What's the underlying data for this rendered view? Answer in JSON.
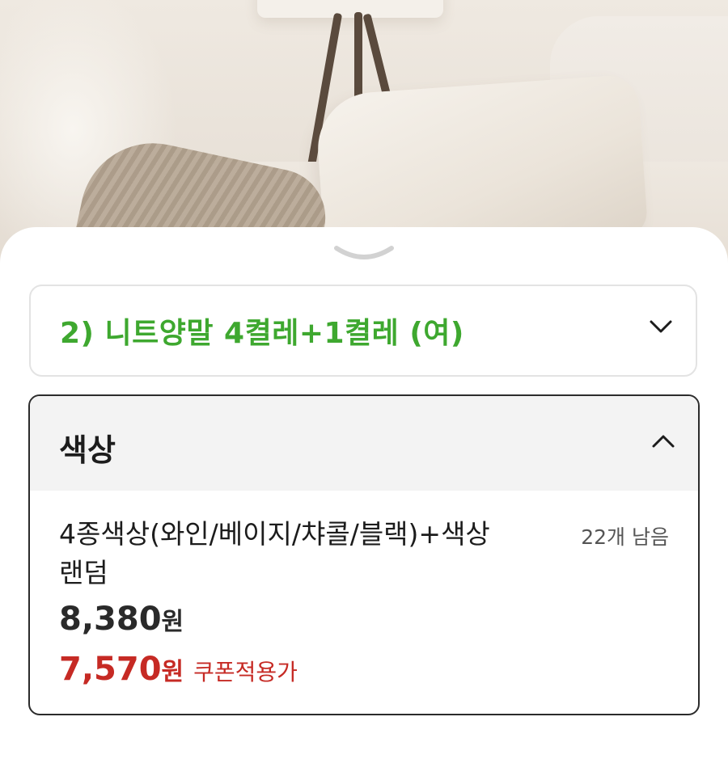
{
  "option_selector": {
    "selected_value": "2) 니트양말 4켤레+1켤레 (여)"
  },
  "color_section": {
    "title": "색상",
    "options": [
      {
        "name": "4종색상(와인/베이지/챠콜/블랙)+색상랜덤",
        "stock": "22개 남음",
        "price": "8,380",
        "price_unit": "원",
        "coupon_price": "7,570",
        "coupon_price_unit": "원",
        "coupon_label": "쿠폰적용가"
      }
    ]
  },
  "colors": {
    "option_text": "#3ea82f",
    "coupon_price": "#c62a24",
    "panel_border": "#2b2b2b",
    "panel_header_bg": "#f3f3f3"
  },
  "icons": {
    "sheet_handle": "chevron-down-icon",
    "selector_chevron": "chevron-down-icon",
    "panel_chevron": "chevron-up-icon"
  }
}
